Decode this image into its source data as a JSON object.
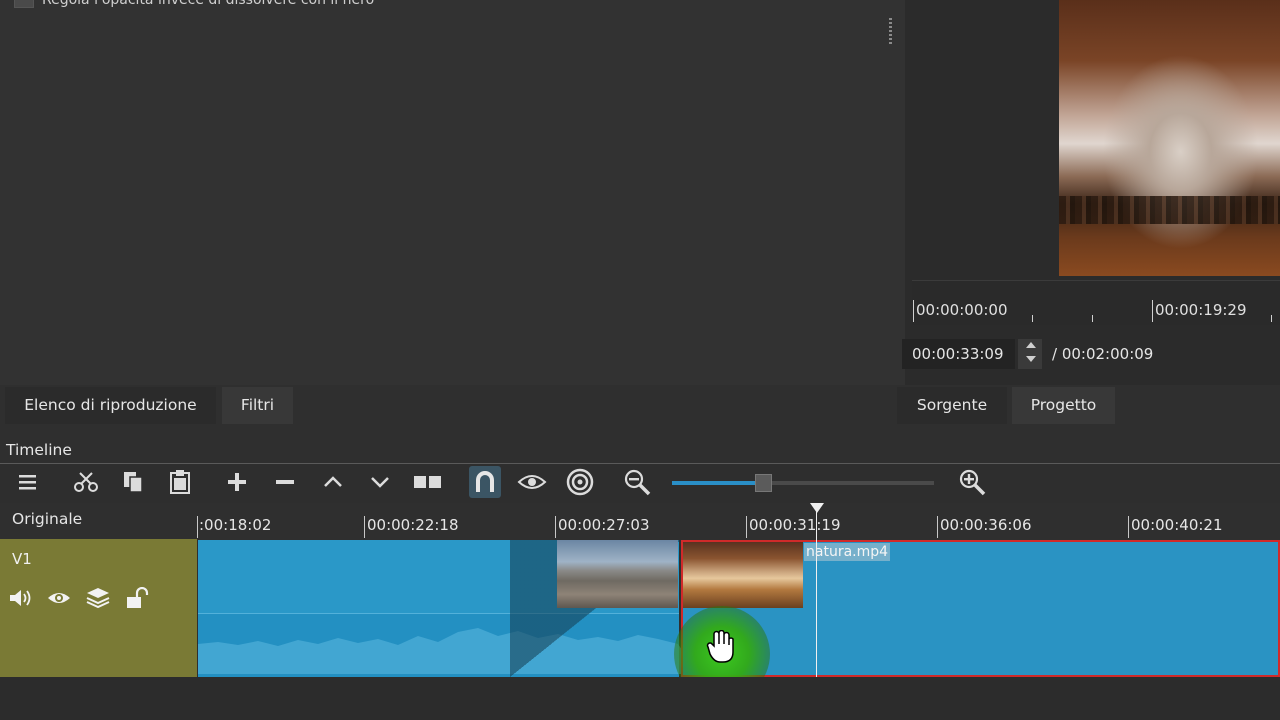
{
  "hint": {
    "text": "Regola l'opacità invece di dissolvere con il nero"
  },
  "player": {
    "ruler_labels": [
      "00:00:00:00",
      "00:00:19:29"
    ],
    "current_time": "00:00:33:09",
    "total_time": "/ 00:02:00:09"
  },
  "tabs": {
    "left": [
      {
        "label": "Elenco di riproduzione"
      },
      {
        "label": "Filtri"
      }
    ],
    "right": [
      {
        "label": "Sorgente"
      },
      {
        "label": "Progetto"
      }
    ]
  },
  "timeline": {
    "title": "Timeline",
    "toolbar": {
      "icons": [
        "menu-icon",
        "cut-icon",
        "copy-icon",
        "paste-icon",
        "append-icon",
        "remove-icon",
        "lift-icon",
        "overwrite-icon",
        "split-icon",
        "snap-icon",
        "scrub-icon",
        "ripple-icon",
        "zoom-out-icon",
        "zoom-in-icon"
      ],
      "zoom_level": 0.35,
      "accent_color": "#2a8fc7"
    },
    "ruler_header": "Originale",
    "ruler_labels": [
      ":00:18:02",
      "00:00:22:18",
      "00:00:27:03",
      "00:00:31:19",
      "00:00:36:06",
      "00:00:40:21"
    ],
    "tracks": [
      {
        "name": "V1",
        "icons": [
          "mute-icon",
          "eye-icon",
          "layers-icon",
          "lock-icon"
        ],
        "header_color": "#7a7a35",
        "clips": [
          {
            "label": "",
            "color": "#2a98c8"
          },
          {
            "label": "natura.mp4",
            "color": "#2a93c3",
            "selected": true,
            "selection_color": "#d02a2a"
          }
        ]
      }
    ]
  }
}
